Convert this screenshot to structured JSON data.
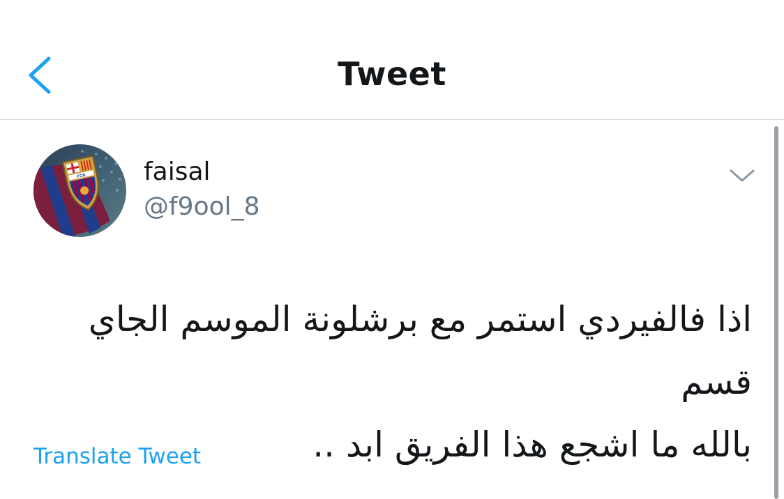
{
  "header": {
    "title": "Tweet",
    "back_icon": "chevron-left-icon"
  },
  "tweet": {
    "user": {
      "name": "faisal",
      "handle": "@f9ool_8",
      "avatar_icon": "fc-barcelona-crest-avatar"
    },
    "menu_icon": "chevron-down-icon",
    "text_lines": [
      "اذا فالفيردي استمر مع برشلونة الموسم الجاي قسم",
      "بالله ما اشجع هذا الفريق ابد .."
    ],
    "translate_label": "Translate Tweet"
  },
  "colors": {
    "accent": "#1da1f2",
    "text_primary": "#14171a",
    "text_secondary": "#657786",
    "divider": "#d8dde2"
  }
}
